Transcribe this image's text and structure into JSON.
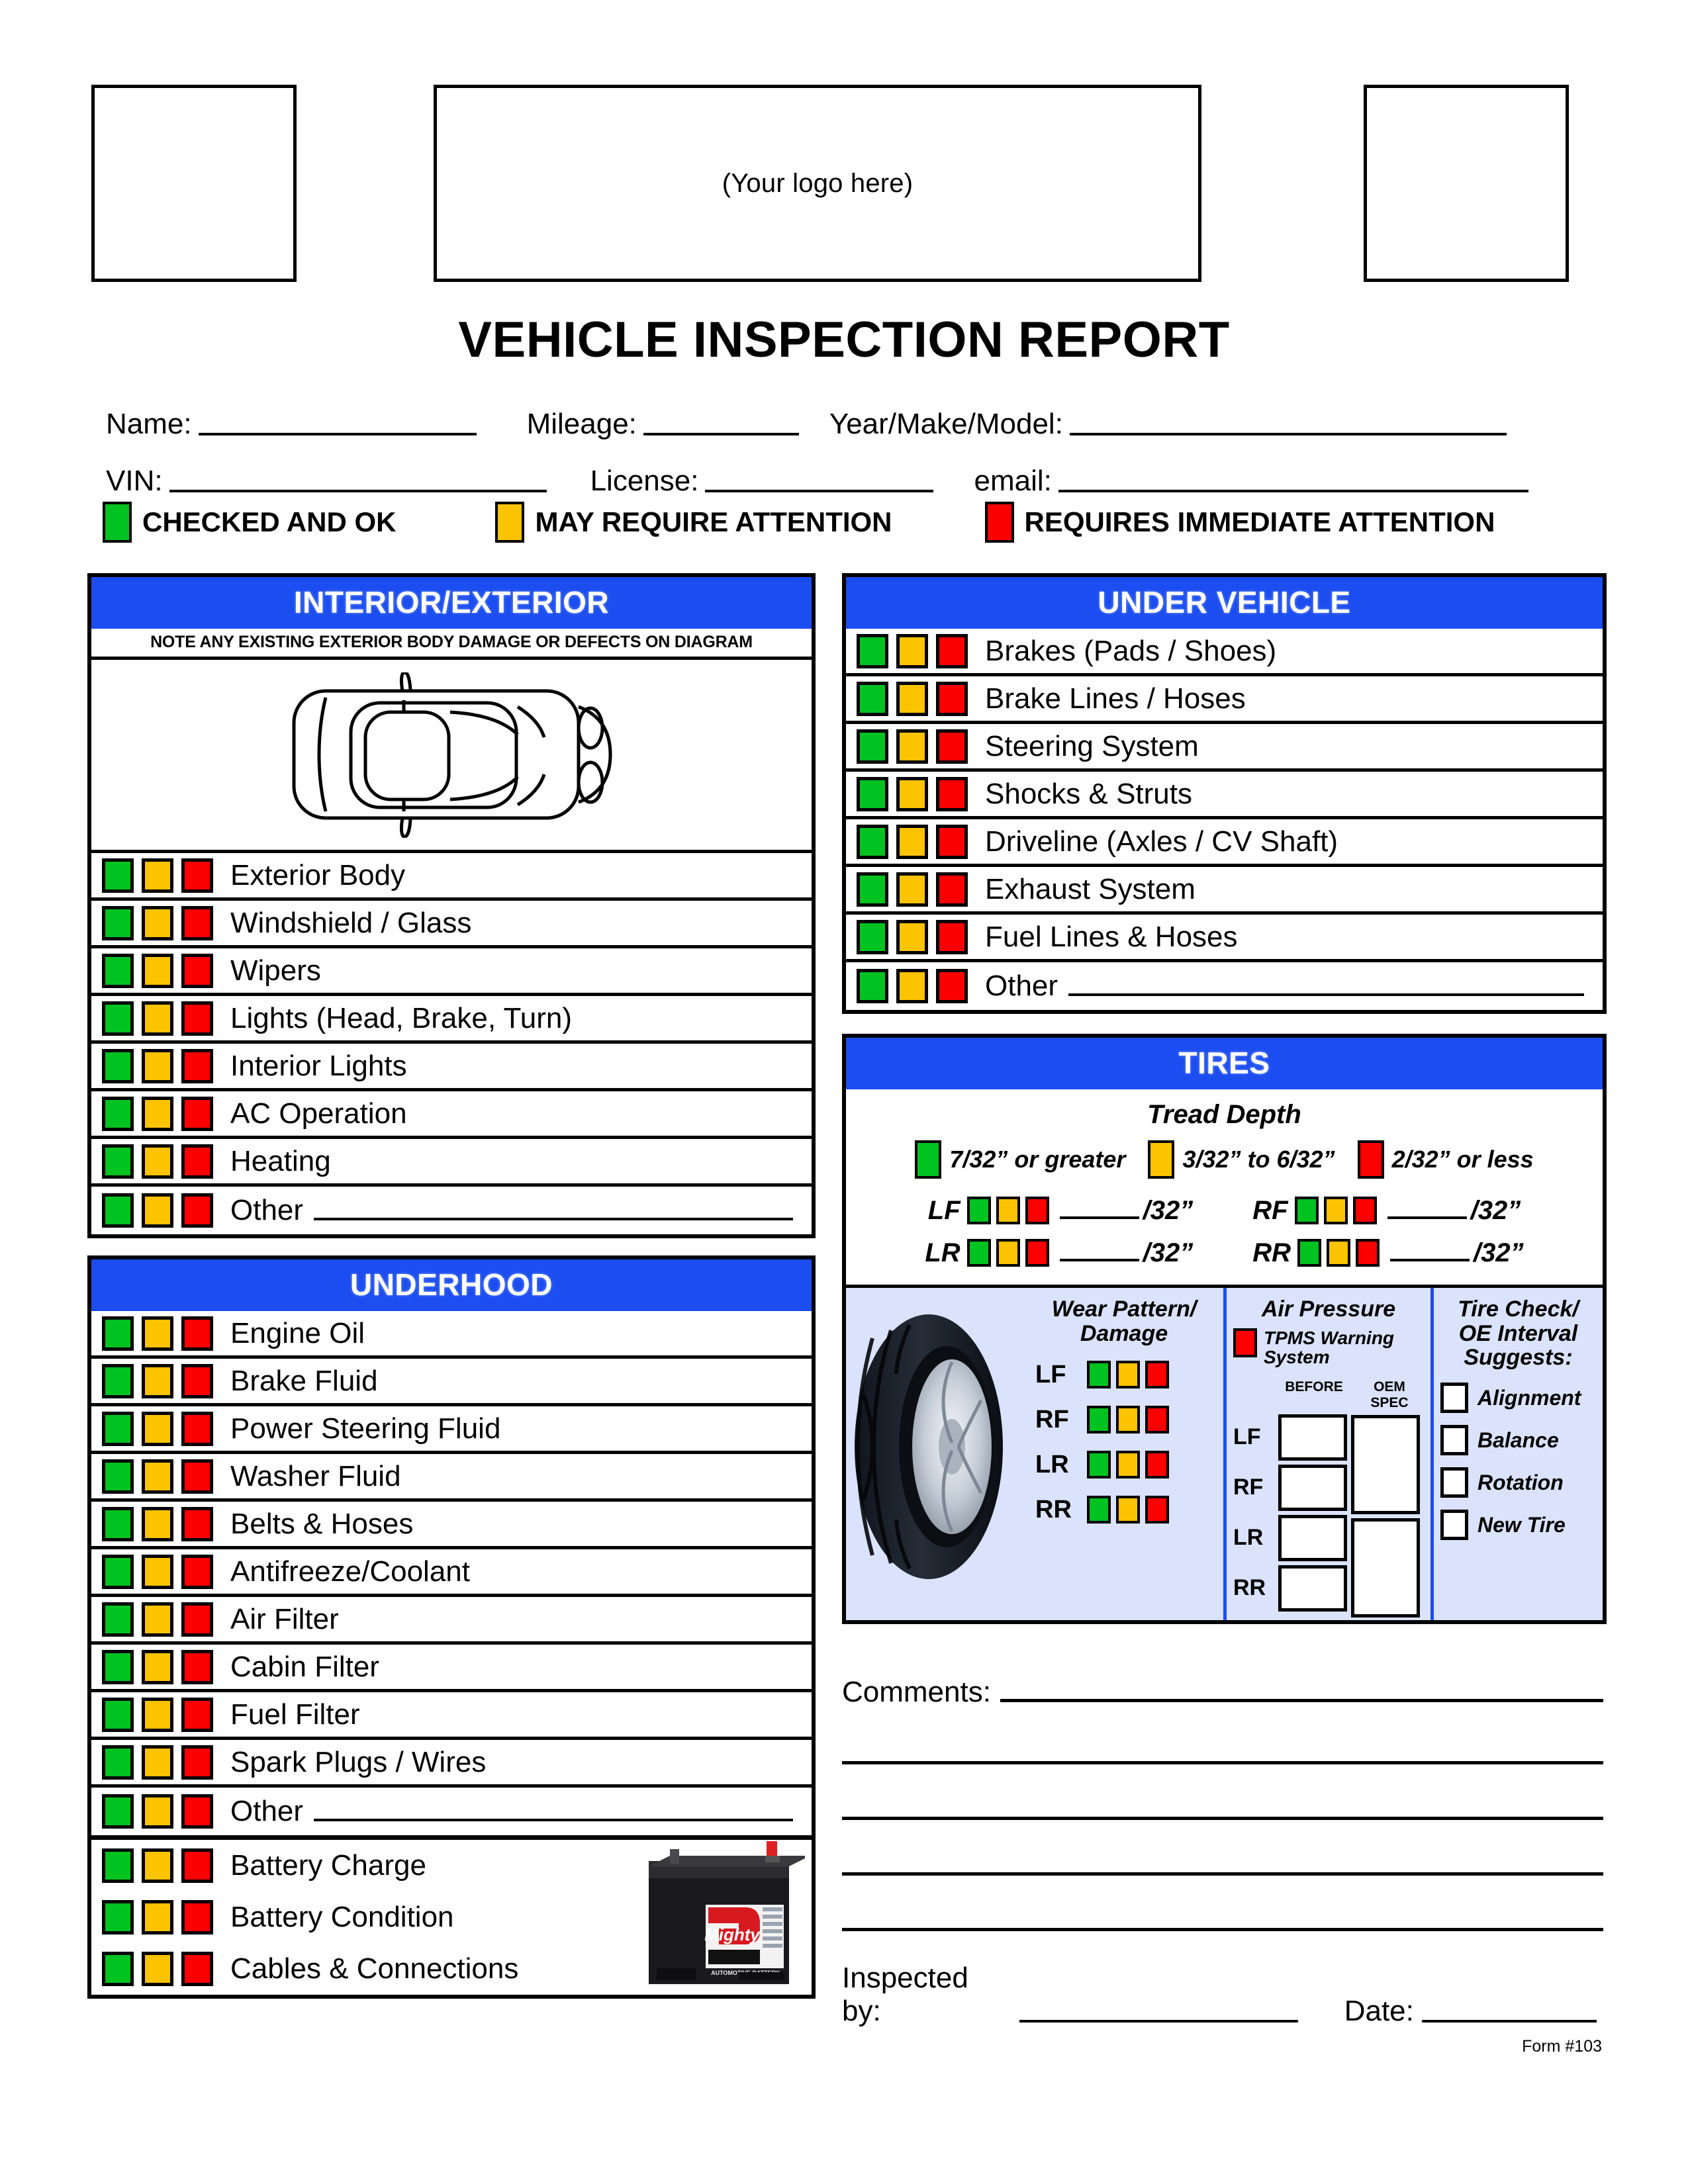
{
  "header": {
    "logo_placeholder": "(Your logo here)",
    "title": "VEHICLE INSPECTION REPORT"
  },
  "info": {
    "name_label": "Name:",
    "mileage_label": "Mileage:",
    "year_make_model_label": "Year/Make/Model:",
    "vin_label": "VIN:",
    "license_label": "License:",
    "email_label": "email:"
  },
  "legend": {
    "items": [
      {
        "label": "CHECKED AND OK",
        "color": "#00c221"
      },
      {
        "label": "MAY REQUIRE ATTENTION",
        "color": "#fcc300"
      },
      {
        "label": "REQUIRES IMMEDIATE ATTENTION",
        "color": "#fc0000"
      }
    ]
  },
  "colors": {
    "green": "#00c221",
    "yellow": "#fcc300",
    "red": "#fc0000",
    "header_blue": "#1b4df0",
    "tire_panel_bg": "#dae3fb"
  },
  "sections": {
    "interior_exterior": {
      "title": "INTERIOR/EXTERIOR",
      "note": "NOTE ANY EXISTING EXTERIOR BODY DAMAGE OR DEFECTS ON DIAGRAM",
      "items": [
        "Exterior Body",
        "Windshield / Glass",
        "Wipers",
        "Lights (Head, Brake, Turn)",
        "Interior Lights",
        "AC Operation",
        "Heating",
        "Other"
      ],
      "other_index": 7
    },
    "underhood": {
      "title": "UNDERHOOD",
      "items": [
        "Engine Oil",
        "Brake Fluid",
        "Power Steering Fluid",
        "Washer Fluid",
        "Belts & Hoses",
        "Antifreeze/Coolant",
        "Air Filter",
        "Cabin Filter",
        "Fuel Filter",
        "Spark Plugs / Wires",
        "Other"
      ],
      "other_index": 10,
      "battery_items": [
        "Battery Charge",
        "Battery Condition",
        "Cables & Connections"
      ],
      "battery_brand": "Mighty",
      "battery_sub": "AUTOMOTIVE BATTERY"
    },
    "under_vehicle": {
      "title": "UNDER VEHICLE",
      "items": [
        "Brakes (Pads / Shoes)",
        "Brake Lines / Hoses",
        "Steering System",
        "Shocks & Struts",
        "Driveline (Axles / CV Shaft)",
        "Exhaust System",
        "Fuel Lines & Hoses",
        "Other"
      ],
      "other_index": 7
    },
    "tires": {
      "title": "TIRES",
      "tread_depth_title": "Tread Depth",
      "tread_legend": [
        {
          "label": "7/32” or greater",
          "color": "#00c221"
        },
        {
          "label": "3/32” to 6/32”",
          "color": "#fcc300"
        },
        {
          "label": "2/32” or less",
          "color": "#fc0000"
        }
      ],
      "tread_positions": [
        "LF",
        "RF",
        "LR",
        "RR"
      ],
      "tread_unit": "/32”",
      "wear_pattern_title": "Wear Pattern/ Damage",
      "wear_positions": [
        "LF",
        "RF",
        "LR",
        "RR"
      ],
      "air_pressure_title": "Air Pressure",
      "tpms_label": "TPMS Warning System",
      "air_col_before": "BEFORE",
      "air_col_oem": "OEM SPEC",
      "air_positions": [
        "LF",
        "RF",
        "LR",
        "RR"
      ],
      "tire_check_title": "Tire Check/ OE Interval Suggests:",
      "tire_check_items": [
        "Alignment",
        "Balance",
        "Rotation",
        "New Tire"
      ]
    }
  },
  "footer": {
    "comments_label": "Comments:",
    "inspected_by_label": "Inspected by:",
    "date_label": "Date:",
    "form_number": "Form #103"
  }
}
